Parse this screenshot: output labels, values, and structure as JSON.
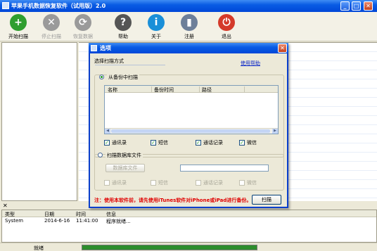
{
  "window": {
    "title": "苹果手机数据恢复软件（试用版）2.0",
    "min_glyph": "_",
    "max_glyph": "□",
    "close_glyph": "✕"
  },
  "toolbar": [
    {
      "id": "start-scan",
      "label": "开始扫描",
      "icon": "plus-icon",
      "color": "#2f9e2f",
      "glyph": "+",
      "enabled": true
    },
    {
      "id": "stop-scan",
      "label": "停止扫描",
      "icon": "stop-icon",
      "color": "#9a9a9a",
      "glyph": "✕",
      "enabled": false
    },
    {
      "id": "restore-data",
      "label": "恢复数据",
      "icon": "restore-icon",
      "color": "#9a9a9a",
      "glyph": "⟳",
      "enabled": false
    },
    {
      "id": "help",
      "label": "帮助",
      "icon": "help-icon",
      "color": "#555555",
      "glyph": "?",
      "enabled": true
    },
    {
      "id": "about",
      "label": "关于",
      "icon": "info-icon",
      "color": "#1a8fd8",
      "glyph": "i",
      "enabled": true
    },
    {
      "id": "register",
      "label": "注册",
      "icon": "register-icon",
      "color": "#6d7f99",
      "glyph": "▮",
      "enabled": true
    },
    {
      "id": "exit",
      "label": "退出",
      "icon": "power-icon",
      "color": "#d43a2a",
      "glyph": "⏻",
      "enabled": true
    }
  ],
  "dialog": {
    "title": "选项",
    "close_glyph": "✕",
    "scan_mode_label": "选择扫描方式",
    "help_link": "使用帮助",
    "backup_option": "从备份中扫描",
    "backup_columns": [
      "名称",
      "备份时间",
      "路径"
    ],
    "backup_types": [
      {
        "label": "通讯录",
        "checked": true
      },
      {
        "label": "短信",
        "checked": true
      },
      {
        "label": "通话记录",
        "checked": true
      },
      {
        "label": "微信",
        "checked": true
      }
    ],
    "db_option": "扫描数据库文件",
    "db_button": "数据库文件",
    "db_path": "",
    "db_types": [
      {
        "label": "通讯录",
        "checked": false
      },
      {
        "label": "短信",
        "checked": false
      },
      {
        "label": "通话记录",
        "checked": false
      },
      {
        "label": "微信",
        "checked": false
      }
    ],
    "note": "注：使用本软件前，请先使用iTunes软件对iPhone或iPad进行备份。",
    "scan_button": "扫描",
    "check_glyph": "✓",
    "arrow_left": "◀",
    "arrow_right": "▶"
  },
  "log": {
    "close_glyph": "✕",
    "columns": [
      "类型",
      "日期",
      "时间",
      "信息"
    ],
    "rows": [
      {
        "type": "System",
        "date": "2014-6-16",
        "time": "11:41:00",
        "info": "程序就绪..."
      }
    ]
  },
  "status": {
    "text": "就绪",
    "progress": 1.0
  }
}
